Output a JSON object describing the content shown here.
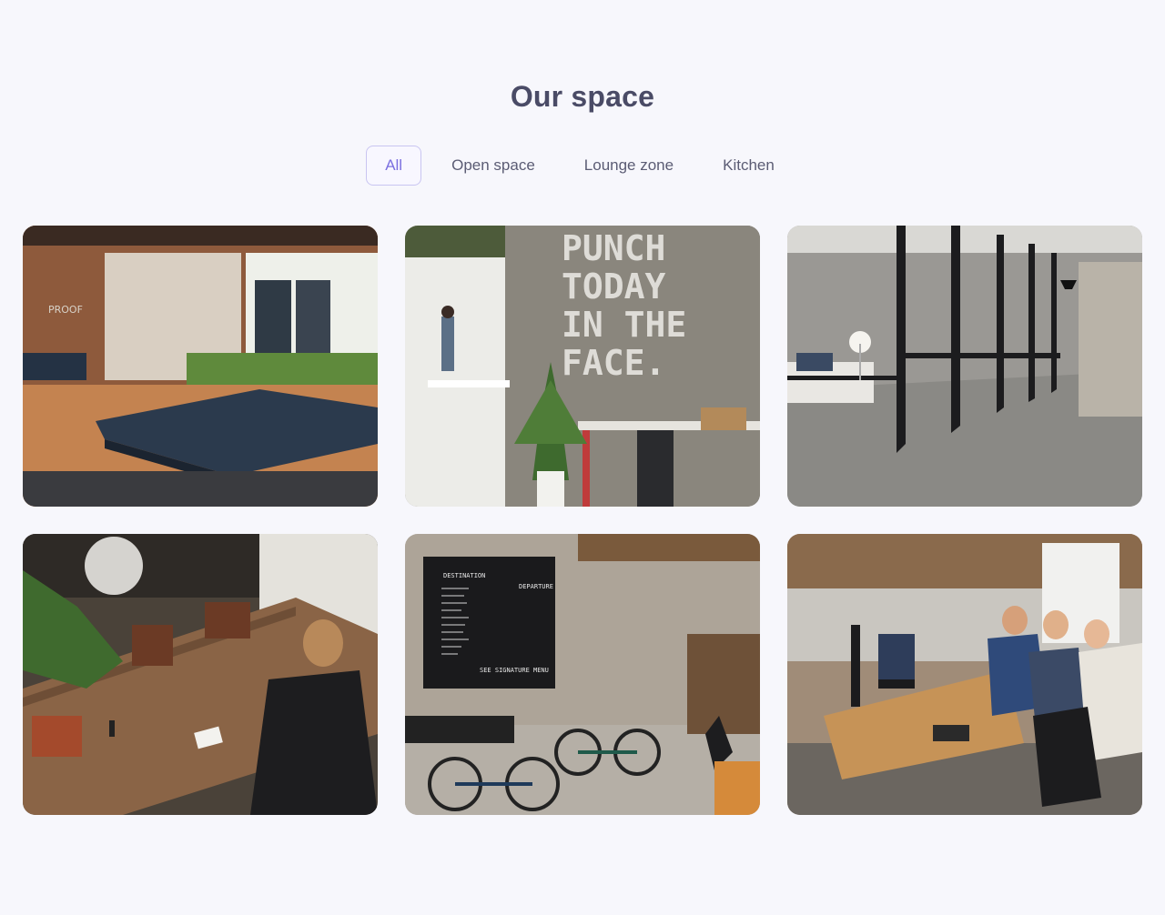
{
  "page": {
    "title": "Our space"
  },
  "tabs": [
    {
      "label": "All",
      "active": true
    },
    {
      "label": "Open space",
      "active": false
    },
    {
      "label": "Lounge zone",
      "active": false
    },
    {
      "label": "Kitchen",
      "active": false
    }
  ],
  "gallery": {
    "photo2": {
      "wall_text": [
        "PUNCH",
        "TODAY",
        "IN THE",
        "FACE."
      ]
    },
    "photo5": {
      "board_title_left": "DESTINATION",
      "board_title_right": "DEPARTURE",
      "board_footer": "SEE SIGNATURE MENU"
    },
    "photo1": {
      "sign": "PROOF"
    }
  },
  "colors": {
    "background": "#f7f7fc",
    "accent": "#7b6fe0",
    "text": "#4a4b66"
  }
}
